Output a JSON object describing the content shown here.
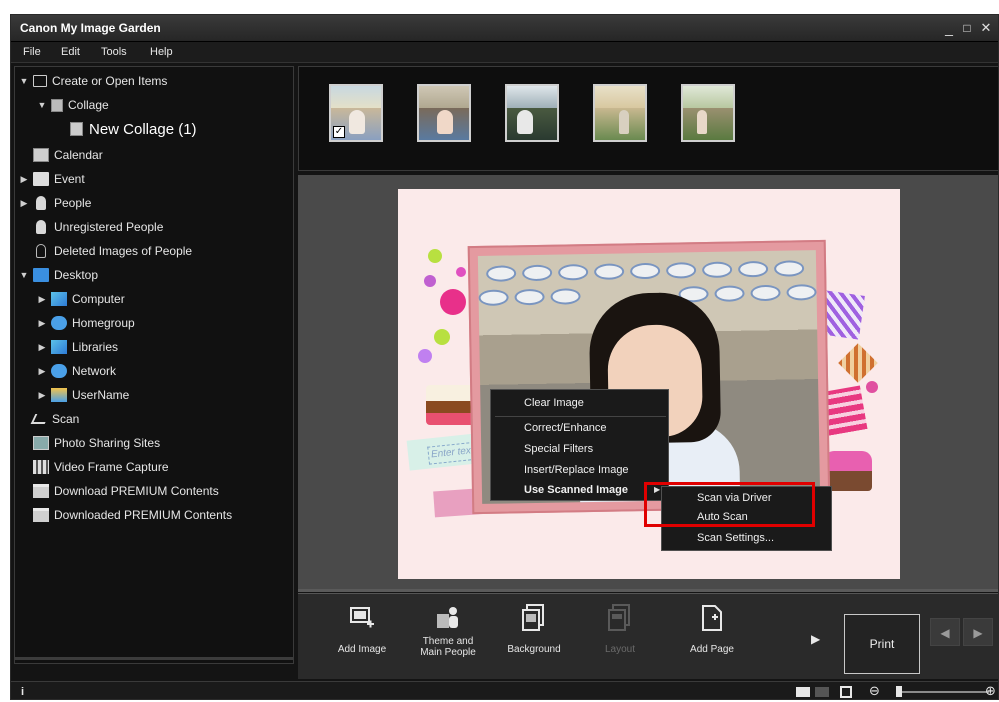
{
  "window": {
    "title": "Canon My Image Garden",
    "controls": {
      "minimize": "_",
      "maximize": "□",
      "close": "✕"
    }
  },
  "menubar": [
    "File",
    "Edit",
    "Tools",
    "Help"
  ],
  "sidebar": {
    "items": [
      {
        "label": "Create or Open Items",
        "arrow": "▼",
        "icon": "create-items-icon"
      },
      {
        "label": "Collage",
        "arrow": "▼",
        "icon": "collage-icon"
      },
      {
        "label": "New Collage (1)",
        "arrow": "",
        "icon": "collage-doc-icon"
      },
      {
        "label": "Calendar",
        "arrow": "",
        "icon": "calendar-icon"
      },
      {
        "label": "Event",
        "arrow": "▶",
        "icon": "event-icon"
      },
      {
        "label": "People",
        "arrow": "▶",
        "icon": "people-icon"
      },
      {
        "label": "Unregistered People",
        "arrow": "",
        "icon": "unregistered-people-icon"
      },
      {
        "label": "Deleted Images of People",
        "arrow": "",
        "icon": "deleted-people-icon"
      },
      {
        "label": "Desktop",
        "arrow": "▼",
        "icon": "desktop-icon"
      },
      {
        "label": "Computer",
        "arrow": "▶",
        "icon": "computer-icon"
      },
      {
        "label": "Homegroup",
        "arrow": "▶",
        "icon": "homegroup-icon"
      },
      {
        "label": "Libraries",
        "arrow": "▶",
        "icon": "libraries-icon"
      },
      {
        "label": "Network",
        "arrow": "▶",
        "icon": "network-icon"
      },
      {
        "label": "UserName",
        "arrow": "▶",
        "icon": "user-folder-icon"
      },
      {
        "label": "Scan",
        "arrow": "",
        "icon": "scan-icon"
      },
      {
        "label": "Photo Sharing Sites",
        "arrow": "",
        "icon": "photo-sharing-icon"
      },
      {
        "label": "Video Frame Capture",
        "arrow": "",
        "icon": "video-frame-icon"
      },
      {
        "label": "Download PREMIUM Contents",
        "arrow": "",
        "icon": "download-premium-icon"
      },
      {
        "label": "Downloaded PREMIUM Contents",
        "arrow": "",
        "icon": "downloaded-premium-icon"
      }
    ]
  },
  "thumbnails": {
    "count": 5,
    "checked": "✓"
  },
  "canvas": {
    "text_placeholder": "Enter tex",
    "context_menu": [
      "Clear Image",
      "Correct/Enhance",
      "Special Filters",
      "Insert/Replace Image",
      "Use Scanned Image"
    ],
    "submenu_arrow": "▶",
    "submenu": [
      "Scan via Driver",
      "Auto Scan",
      "Scan Settings..."
    ]
  },
  "toolbar": {
    "tools": [
      {
        "label": "Add Image",
        "disabled": false
      },
      {
        "label": "Theme and Main People",
        "disabled": false
      },
      {
        "label": "Background",
        "disabled": false
      },
      {
        "label": "Layout",
        "disabled": true
      },
      {
        "label": "Add Page",
        "disabled": false
      }
    ],
    "more_arrow": "▶",
    "print_label": "Print",
    "prev_arrow": "◀",
    "next_arrow": "▶"
  },
  "statusbar": {
    "info": "i",
    "zoom_out": "⊖",
    "zoom_in": "⊕"
  }
}
